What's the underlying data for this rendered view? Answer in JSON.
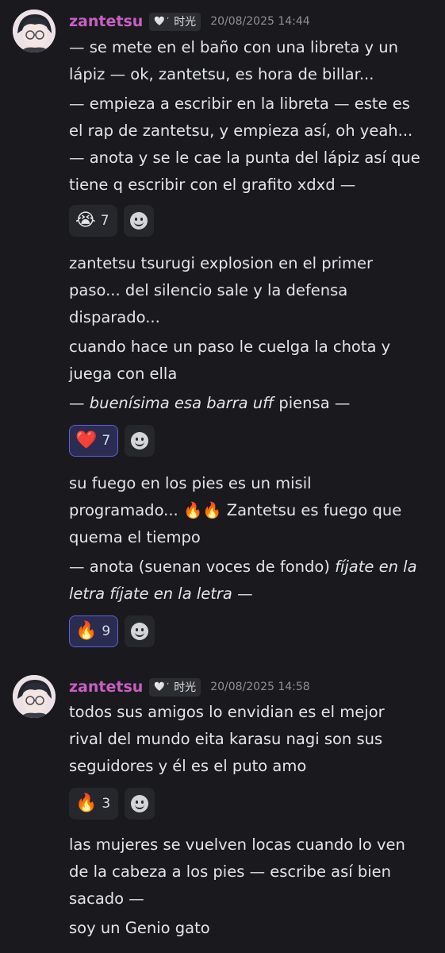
{
  "messages": [
    {
      "username": "zantetsu",
      "tag_heart": "🤍",
      "tag_dot": "ʼ",
      "tag_text": "时光",
      "timestamp": "20/08/2025 14:44",
      "lines": [
        "— se mete en el baño con una libreta y un",
        "lápiz — ok, zantetsu, es hora de billar...",
        "— empieza a escribir en la libreta — este es",
        "el rap de zantetsu, y empieza así, oh yeah...",
        "— anota y se le cae la punta del lápiz así que",
        "tiene q escribir con el grafito xdxd —",
        "zantetsu tsurugi explosion en el primer",
        "paso... del silencio sale y la defensa",
        "disparado...",
        "cuando hace un paso le cuelga la chota y",
        "juega con ella",
        "su fuego en los pies es un misil",
        "quema el tiempo"
      ],
      "line_italic_1": {
        "prefix": "— ",
        "italic": "buenísima esa barra uff",
        "suffix": " piensa —"
      },
      "line_fire": {
        "prefix": "programado... ",
        "emoji": "🔥🔥",
        "suffix": " Zantetsu es fuego que"
      },
      "line_italic_2a": {
        "prefix": "— anota (suenan voces de fondo) ",
        "italic": "fíjate en la"
      },
      "line_italic_2b": {
        "italic": "letra fíjate en la letra",
        "suffix": " —"
      },
      "reactions": [
        {
          "emoji": "😭",
          "count": "7",
          "active": false
        },
        {
          "emoji": "❤️",
          "count": "7",
          "active": true
        },
        {
          "emoji": "🔥",
          "count": "9",
          "active": true
        }
      ]
    },
    {
      "username": "zantetsu",
      "tag_heart": "🤍",
      "tag_dot": "ʼ",
      "tag_text": "时光",
      "timestamp": "20/08/2025 14:58",
      "lines": [
        "todos sus amigos lo envidian es el mejor",
        "rival del mundo eita karasu nagi son sus",
        "seguidores y él es el puto amo",
        "las mujeres se vuelven locas cuando lo ven",
        "de la cabeza a los pies — escribe así bien",
        "sacado —",
        "soy un Genio gato"
      ],
      "reactions": [
        {
          "emoji": "🔥",
          "count": "3",
          "active": false
        }
      ]
    }
  ]
}
